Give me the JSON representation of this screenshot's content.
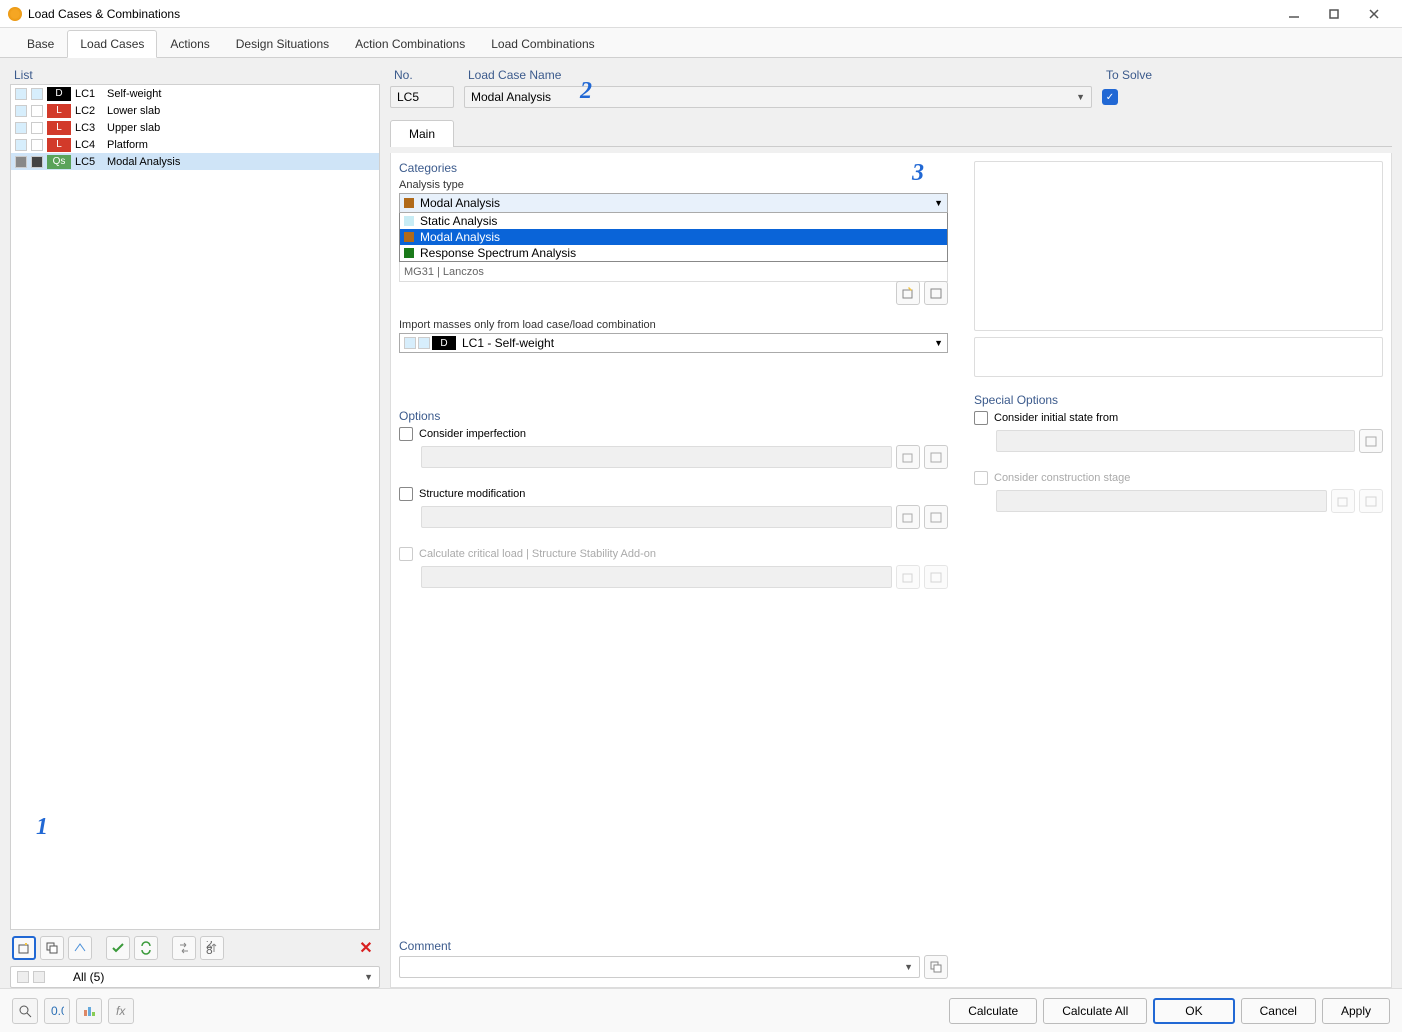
{
  "window": {
    "title": "Load Cases & Combinations"
  },
  "tabs": [
    "Base",
    "Load Cases",
    "Actions",
    "Design Situations",
    "Action Combinations",
    "Load Combinations"
  ],
  "active_tab": "Load Cases",
  "list": {
    "header": "List",
    "items": [
      {
        "code": "LC1",
        "name": "Self-weight",
        "badge": "D",
        "badge_bg": "#000000",
        "sw1": "#d7eefc",
        "sw2": "#d7eefc"
      },
      {
        "code": "LC2",
        "name": "Lower slab",
        "badge": "L",
        "badge_bg": "#d23a2a",
        "sw1": "#d7eefc",
        "sw2": "#ffffff"
      },
      {
        "code": "LC3",
        "name": "Upper slab",
        "badge": "L",
        "badge_bg": "#d23a2a",
        "sw1": "#d7eefc",
        "sw2": "#ffffff"
      },
      {
        "code": "LC4",
        "name": "Platform",
        "badge": "L",
        "badge_bg": "#d23a2a",
        "sw1": "#d7eefc",
        "sw2": "#ffffff"
      },
      {
        "code": "LC5",
        "name": "Modal Analysis",
        "badge": "Qs",
        "badge_bg": "#5aa35a",
        "sw1": "#888888",
        "sw2": "#444444",
        "selected": true
      }
    ],
    "filter": "All (5)"
  },
  "detail": {
    "no_label": "No.",
    "no_value": "LC5",
    "name_label": "Load Case Name",
    "name_value": "Modal Analysis",
    "solve_label": "To Solve",
    "solve_checked": true,
    "inner_tab": "Main"
  },
  "categories": {
    "header": "Categories",
    "analysis_type_label": "Analysis type",
    "selected": "Modal Analysis",
    "color": "#b06a1a",
    "options": [
      {
        "label": "Static Analysis",
        "color": "#c7ecf5"
      },
      {
        "label": "Modal Analysis",
        "color": "#b06a1a",
        "highlighted": true
      },
      {
        "label": "Response Spectrum Analysis",
        "color": "#1a7a1a"
      }
    ],
    "masked_row": "MG31      |  Lanczos",
    "import_label": "Import masses only from load case/load combination",
    "import_value": "LC1 - Self-weight",
    "import_badge": "D",
    "import_badge_bg": "#000000"
  },
  "options": {
    "header": "Options",
    "imperfection": "Consider imperfection",
    "structure_mod": "Structure modification",
    "critical_load": "Calculate critical load | Structure Stability Add-on"
  },
  "special_options": {
    "header": "Special Options",
    "initial_state": "Consider initial state from",
    "construction_stage": "Consider construction stage"
  },
  "comment": {
    "header": "Comment",
    "value": ""
  },
  "footer": {
    "calculate": "Calculate",
    "calculate_all": "Calculate All",
    "ok": "OK",
    "cancel": "Cancel",
    "apply": "Apply"
  },
  "annotations": {
    "a1": "1",
    "a2": "2",
    "a3": "3"
  }
}
